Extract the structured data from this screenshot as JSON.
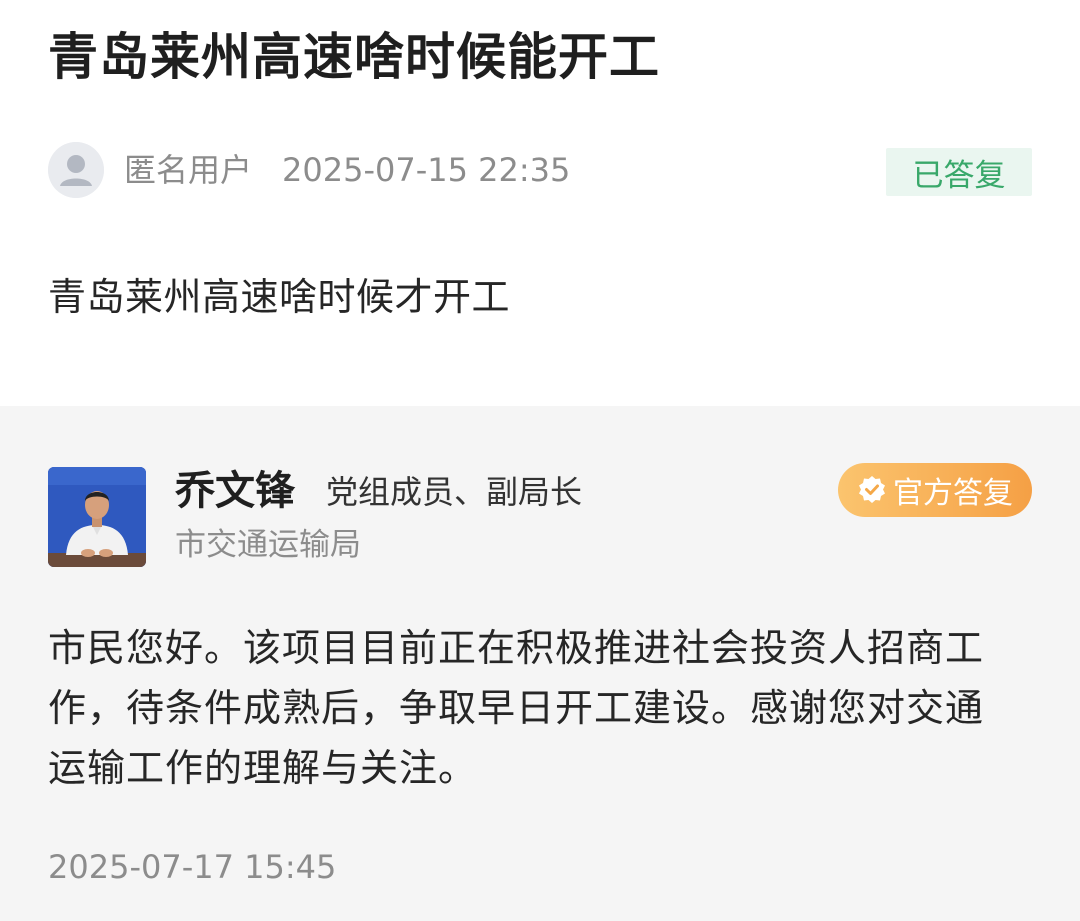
{
  "question": {
    "title": "青岛莱州高速啥时候能开工",
    "asker": {
      "name": "匿名用户",
      "avatar_icon": "user-avatar-icon"
    },
    "time": "2025-07-15 22:35",
    "status": "已答复",
    "body": "青岛莱州高速啥时候才开工"
  },
  "answer": {
    "official": {
      "name": "乔文锋",
      "title": "党组成员、副局长",
      "department": "市交通运输局",
      "photo": "official-portrait"
    },
    "badge": {
      "label": "官方答复",
      "icon": "check-badge-icon",
      "colors": [
        "#fbc46e",
        "#f5a045"
      ]
    },
    "body_lines": [
      "市民您好。该项目目前正在积极推进社会投资人招商工",
      "作，待条件成熟后，争取早日开工建设。感谢您对交通",
      "运输工作的理解与关注。"
    ],
    "time": "2025-07-17 15:45"
  },
  "colors": {
    "status_bg": "#eaf6f0",
    "status_text": "#39a86a",
    "answer_bg": "#f5f5f5",
    "muted_text": "#8c8c8c"
  }
}
